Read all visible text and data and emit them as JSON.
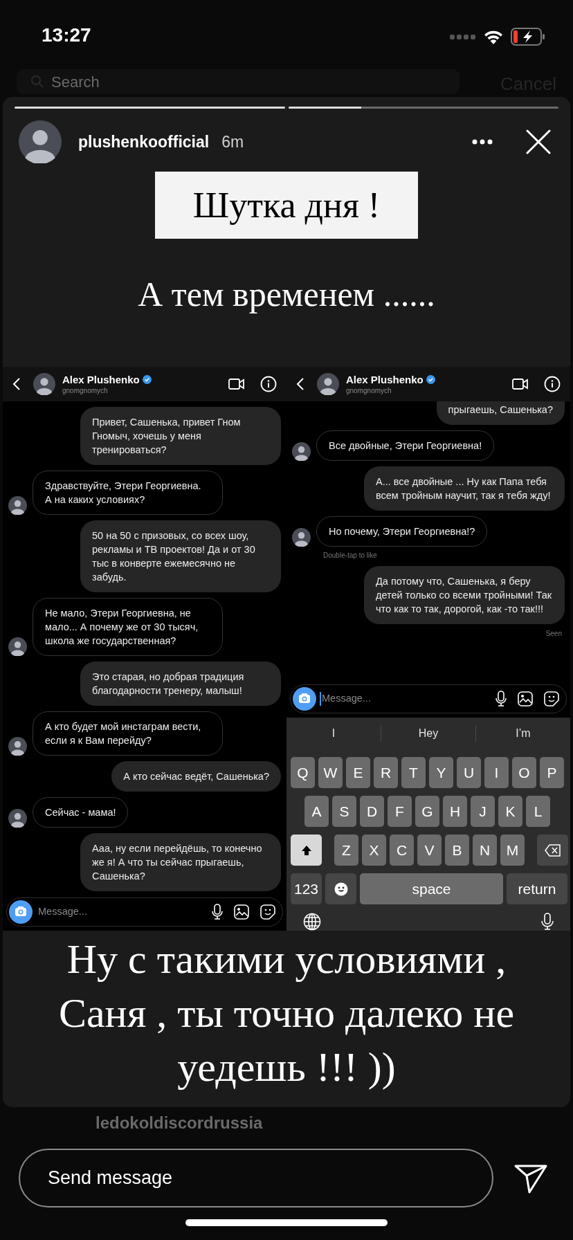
{
  "status_bar": {
    "time": "13:27"
  },
  "background": {
    "search_placeholder": "Search",
    "cancel": "Cancel",
    "list_item": "ledokoldiscordrussia"
  },
  "story": {
    "progress": [
      {
        "level": 1
      },
      {
        "level": 0.27
      }
    ],
    "username": "plushenkoofficial",
    "time": "6m",
    "title": "Шутка дня !",
    "subtitle": "А тем временем ......",
    "screenshots": [
      {
        "contact": {
          "name": "Alex Plushenko",
          "username": "gnomgnomych",
          "verified": true
        },
        "messages": [
          {
            "kind": "outgoing",
            "clipped": false,
            "text": "Привет, Сашенька, привет Гном Гномыч, хочешь у меня тренироваться?"
          },
          {
            "kind": "incoming",
            "clipped": false,
            "text": "Здравствуйте, Этери Георгиевна. А на каких условиях?"
          },
          {
            "kind": "outgoing",
            "clipped": false,
            "text": "50 на 50 с призовых, со всех шоу, рекламы и ТВ проектов! Да и от 30 тыс в конверте ежемесячно не забудь."
          },
          {
            "kind": "incoming",
            "clipped": false,
            "text": "Не мало, Этери Георгиевна, не мало... А почему же от 30 тысяч, школа же государственная?"
          },
          {
            "kind": "outgoing",
            "clipped": false,
            "text": "Это старая, но добрая традиция благодарности тренеру, малыш!"
          },
          {
            "kind": "incoming",
            "clipped": false,
            "text": "А кто будет мой инстаграм вести, если я к Вам перейду?"
          },
          {
            "kind": "outgoing",
            "clipped": false,
            "text": "А кто сейчас ведёт, Сашенька?"
          },
          {
            "kind": "incoming",
            "clipped": false,
            "text": "Сейчас - мама!"
          },
          {
            "kind": "outgoing",
            "clipped": false,
            "text": "Ааа, ну если перейдёшь, то конечно же я! А что ты сейчас прыгаешь, Сашенька?"
          }
        ],
        "composer": {
          "placeholder": "Message...",
          "focused": false
        }
      },
      {
        "contact": {
          "name": "Alex Plushenko",
          "username": "gnomgnomych",
          "verified": true
        },
        "messages": [
          {
            "kind": "outgoing",
            "clipped": true,
            "text": "прыгаешь, Сашенька?"
          },
          {
            "kind": "incoming",
            "clipped": false,
            "text": "Все двойные, Этери Георгиевна!"
          },
          {
            "kind": "outgoing",
            "clipped": false,
            "text": "А... все двойные ... Ну как Папа тебя всем тройным научит, так я тебя жду!"
          },
          {
            "kind": "incoming",
            "clipped": false,
            "text": "Но почему, Этери Георгиевна!?",
            "note": "Double-tap to like"
          },
          {
            "kind": "outgoing",
            "clipped": false,
            "text": "Да потому что, Сашенька, я беру детей только со всеми тройными! Так что как то так, дорогой, как -то так!!!",
            "note": "Seen"
          }
        ],
        "composer": {
          "placeholder": "Message...",
          "focused": true
        },
        "keyboard": {
          "suggestions": [
            "I",
            "Hey",
            "I’m"
          ],
          "letter_rows": [
            [
              "Q",
              "W",
              "E",
              "R",
              "T",
              "Y",
              "U",
              "I",
              "O",
              "P"
            ],
            [
              "A",
              "S",
              "D",
              "F",
              "G",
              "H",
              "J",
              "K",
              "L"
            ],
            [
              "Z",
              "X",
              "C",
              "V",
              "B",
              "N",
              "M"
            ]
          ],
          "shift_on": true,
          "bottom_row": [
            {
              "kind": "numbers",
              "label": "123"
            },
            {
              "kind": "emoji"
            },
            {
              "kind": "space",
              "label": "space"
            },
            {
              "kind": "return",
              "label": "return"
            }
          ]
        }
      }
    ],
    "caption": "Ну с такими условиями , Саня , ты точно далеко не уедешь !!! ))"
  },
  "reply": {
    "placeholder": "Send message"
  }
}
